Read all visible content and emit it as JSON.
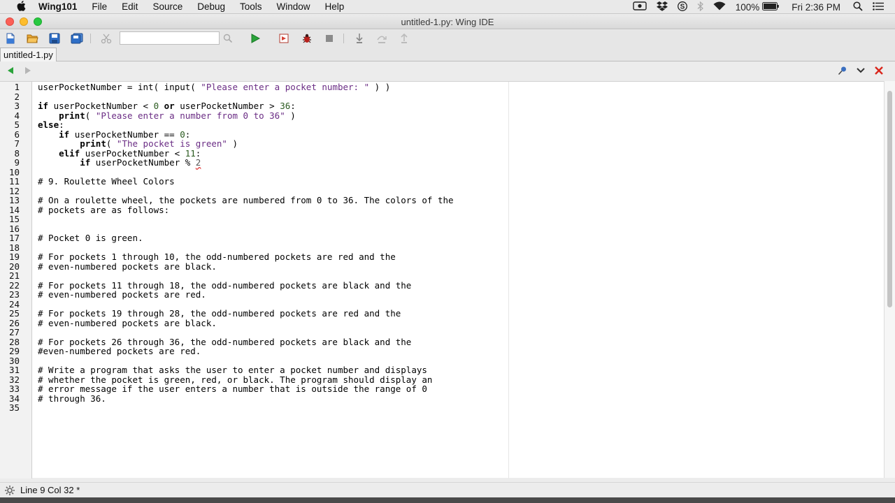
{
  "menubar": {
    "app_name": "Wing101",
    "items": [
      "File",
      "Edit",
      "Source",
      "Debug",
      "Tools",
      "Window",
      "Help"
    ],
    "battery": "100%",
    "clock": "Fri 2:36 PM"
  },
  "window": {
    "title": "untitled-1.py: Wing IDE"
  },
  "toolbar": {
    "search_value": ""
  },
  "editor": {
    "tab_label": "untitled-1.py",
    "line_numbers": [
      "1",
      "2",
      "3",
      "4",
      "5",
      "6",
      "7",
      "8",
      "9",
      "10",
      "11",
      "12",
      "13",
      "14",
      "15",
      "16",
      "17",
      "18",
      "19",
      "20",
      "21",
      "22",
      "23",
      "24",
      "25",
      "26",
      "27",
      "28",
      "29",
      "30",
      "31",
      "32",
      "33",
      "34",
      "35"
    ],
    "code": {
      "l1_a": "userPocketNumber = int( input( ",
      "l1_b": "\"Please enter a pocket number: \"",
      "l1_c": " ) )",
      "l3_if": "if",
      "l3_a": " userPocketNumber < ",
      "l3_n0": "0",
      "l3_or": " or",
      "l3_b": " userPocketNumber > ",
      "l3_n36": "36",
      "l3_c": ":",
      "l4_print": "print",
      "l4_a": "( ",
      "l4_str": "\"Please enter a number from 0 to 36\"",
      "l4_b": " )",
      "l5_else": "else",
      "l5_colon": ":",
      "l6_if": "if",
      "l6_a": " userPocketNumber == ",
      "l6_n": "0",
      "l6_b": ":",
      "l7_print": "print",
      "l7_a": "( ",
      "l7_str": "\"The pocket is green\"",
      "l7_b": " )",
      "l8_elif": "elif",
      "l8_a": " userPocketNumber < ",
      "l8_n": "11",
      "l8_b": ":",
      "l9_if": "if",
      "l9_a": " userPocketNumber % ",
      "l9_n": "2",
      "l11": "# 9. Roulette Wheel Colors",
      "l13": "# On a roulette wheel, the pockets are numbered from 0 to 36. The colors of the",
      "l14": "# pockets are as follows:",
      "l17": "# Pocket 0 is green.",
      "l19": "# For pockets 1 through 10, the odd-numbered pockets are red and the",
      "l20": "# even-numbered pockets are black.",
      "l22": "# For pockets 11 through 18, the odd-numbered pockets are black and the",
      "l23": "# even-numbered pockets are red.",
      "l25": "# For pockets 19 through 28, the odd-numbered pockets are red and the",
      "l26": "# even-numbered pockets are black.",
      "l28": "# For pockets 26 through 36, the odd-numbered pockets are black and the",
      "l29": "#even-numbered pockets are red.",
      "l31": "# Write a program that asks the user to enter a pocket number and displays",
      "l32": "# whether the pocket is green, red, or black. The program should display an",
      "l33": "# error message if the user enters a number that is outside the range of 0",
      "l34": "# through 36."
    }
  },
  "status": {
    "text": "Line 9 Col 32 *"
  },
  "colors": {
    "comment": "#1e7b1e",
    "string": "#6a2c84",
    "run_green": "#2aa33a",
    "close_red": "#d9261c"
  },
  "icons": [
    "apple-icon",
    "screen-record-icon",
    "dropbox-icon",
    "skype-icon",
    "bluetooth-icon",
    "wifi-icon",
    "battery-icon",
    "spotlight-icon",
    "notification-list-icon",
    "new-file-icon",
    "open-folder-icon",
    "save-icon",
    "save-all-icon",
    "cut-icon",
    "search-icon",
    "run-icon",
    "debug-file-icon",
    "bug-icon",
    "stop-icon",
    "step-into-icon",
    "step-over-icon",
    "step-out-icon",
    "back-arrow-icon",
    "forward-arrow-icon",
    "pin-icon",
    "chevron-down-icon",
    "close-icon",
    "gear-icon"
  ]
}
